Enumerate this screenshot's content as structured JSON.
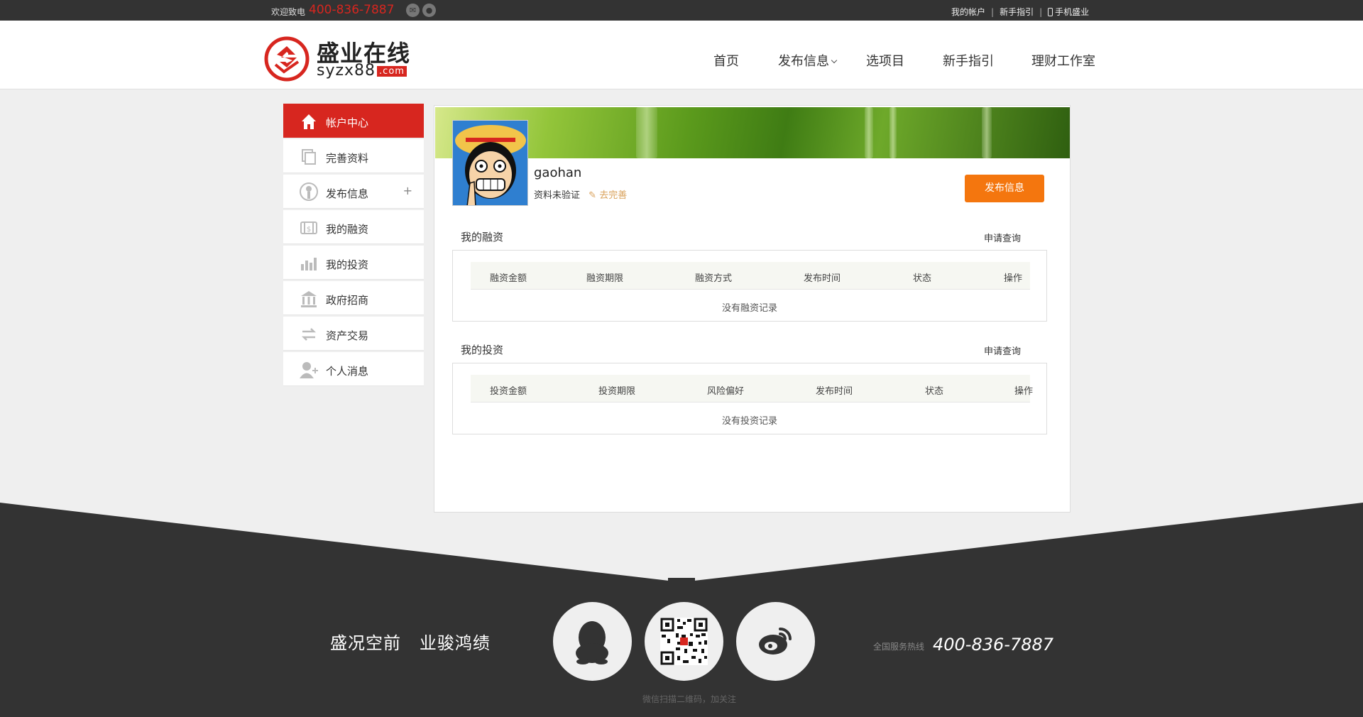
{
  "topbar": {
    "welcome": "欢迎致电",
    "phone": "400-836-7887",
    "my_account": "我的帐户",
    "guide": "新手指引",
    "mobile": "手机盛业"
  },
  "header": {
    "logo_text": "盛业在线",
    "logo_domain": "syzx88",
    "logo_tld": ".com",
    "nav": [
      "首页",
      "发布信息",
      "选项目",
      "新手指引",
      "理财工作室"
    ]
  },
  "sidebar": {
    "items": [
      {
        "label": "帐户中心",
        "icon": "home-icon"
      },
      {
        "label": "完善资料",
        "icon": "profile-icon"
      },
      {
        "label": "发布信息",
        "icon": "publish-icon",
        "expand": "+"
      },
      {
        "label": "我的融资",
        "icon": "financing-icon"
      },
      {
        "label": "我的投资",
        "icon": "investment-icon"
      },
      {
        "label": "政府招商",
        "icon": "government-icon"
      },
      {
        "label": "资产交易",
        "icon": "exchange-icon"
      },
      {
        "label": "个人消息",
        "icon": "message-icon"
      }
    ]
  },
  "profile": {
    "username": "gaohan",
    "verify_status": "资料未验证",
    "complete_link": "去完善",
    "publish_button": "发布信息"
  },
  "financing": {
    "title": "我的融资",
    "query_link": "申请查询",
    "columns": [
      "融资金额",
      "融资期限",
      "融资方式",
      "发布时间",
      "状态",
      "操作"
    ],
    "empty": "没有融资记录"
  },
  "investment": {
    "title": "我的投资",
    "query_link": "申请查询",
    "columns": [
      "投资金额",
      "投资期限",
      "风险偏好",
      "发布时间",
      "状态",
      "操作"
    ],
    "empty": "没有投资记录"
  },
  "footer": {
    "slogan_1": "盛况空前",
    "slogan_2": "业骏鸿绩",
    "hotline_label": "全国服务热线",
    "hotline": "400-836-7887",
    "qr_note": "微信扫描二维码，加关注"
  },
  "colors": {
    "brand_red": "#d7261f",
    "publish_orange": "#f4760e",
    "dark": "#333333"
  }
}
